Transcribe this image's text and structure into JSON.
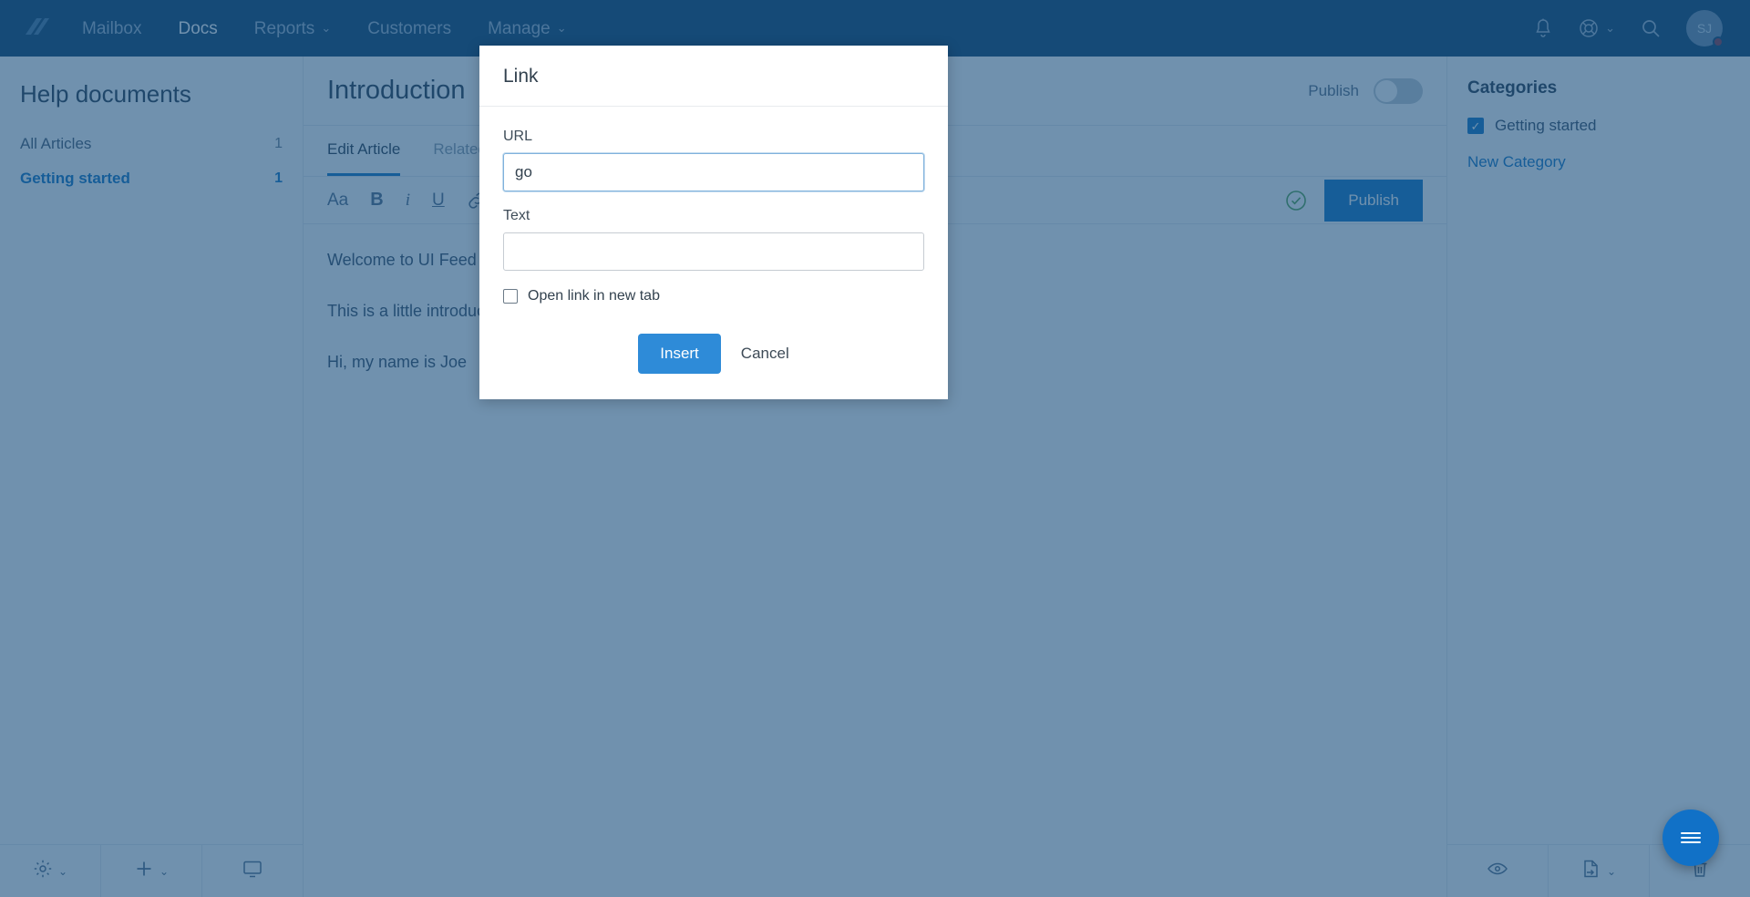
{
  "topnav": {
    "logo_icon": "helpscout-logo-icon",
    "items": [
      {
        "label": "Mailbox",
        "active": false,
        "caret": false
      },
      {
        "label": "Docs",
        "active": true,
        "caret": false
      },
      {
        "label": "Reports",
        "active": false,
        "caret": true
      },
      {
        "label": "Customers",
        "active": false,
        "caret": false
      },
      {
        "label": "Manage",
        "active": false,
        "caret": true
      }
    ],
    "caret_glyph": "⌄",
    "right_icons": [
      {
        "name": "bell-icon"
      },
      {
        "name": "lifebuoy-icon",
        "caret": true
      },
      {
        "name": "search-icon"
      }
    ],
    "avatar_initials": "SJ"
  },
  "sidebar": {
    "collection_title": "Help documents",
    "links": [
      {
        "label": "All Articles",
        "count": "1",
        "selected": false
      },
      {
        "label": "Getting started",
        "count": "1",
        "selected": true
      }
    ],
    "toolbar": [
      {
        "name": "gear-icon",
        "caret": true
      },
      {
        "name": "plus-icon",
        "caret": true
      },
      {
        "name": "monitor-icon",
        "caret": false
      }
    ]
  },
  "article": {
    "title": "Introduction",
    "publish_label": "Publish",
    "publish_on": false,
    "tabs": [
      {
        "label": "Edit Article",
        "active": true
      },
      {
        "label": "Related Articles",
        "active": false
      }
    ],
    "toolbar": [
      {
        "name": "font-size-icon",
        "glyph": "Aa"
      },
      {
        "name": "bold-icon",
        "glyph": "B"
      },
      {
        "name": "italic-icon",
        "glyph": "i"
      },
      {
        "name": "underline-icon",
        "glyph": "U"
      },
      {
        "name": "link-icon",
        "glyph": "🔗"
      },
      {
        "name": "bullet-list-icon",
        "glyph": "☰"
      }
    ],
    "save_status_icon": "check-circle-icon",
    "publish_button": "Publish",
    "content": [
      "Welcome to UI Feed",
      "This is a little introduction about how to use this product",
      "Hi, my name is Joe"
    ]
  },
  "categories": {
    "title": "Categories",
    "items": [
      {
        "label": "Getting started",
        "checked": true
      }
    ],
    "new_category_label": "New Category",
    "check_glyph": "✓",
    "toolbar": [
      {
        "name": "eye-icon",
        "caret": false
      },
      {
        "name": "move-document-icon",
        "caret": true
      },
      {
        "name": "trash-icon",
        "caret": false
      }
    ]
  },
  "modal": {
    "title": "Link",
    "url_label": "URL",
    "url_value": "go",
    "url_placeholder": "",
    "text_label": "Text",
    "text_value": "",
    "text_placeholder": "",
    "new_tab_label": "Open link in new tab",
    "new_tab_checked": false,
    "insert_label": "Insert",
    "cancel_label": "Cancel"
  },
  "beacon": {
    "icon": "beacon-chat-icon"
  },
  "colors": {
    "nav_background": "#12446e",
    "accent_blue": "#1477c4",
    "modal_button_blue": "#2e8bd8",
    "beacon_blue": "#1171c7",
    "veil": "rgba(25,78,124,0.62)"
  }
}
